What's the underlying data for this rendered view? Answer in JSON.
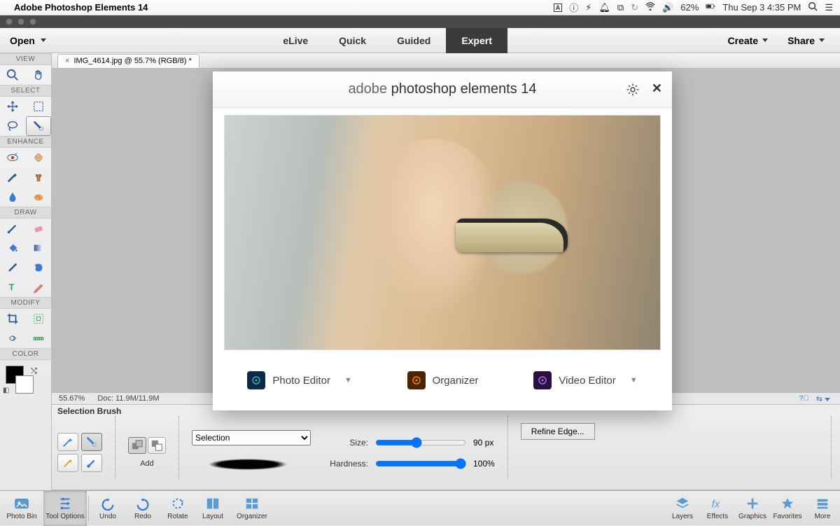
{
  "menubar": {
    "app_title": "Adobe Photoshop Elements 14",
    "battery": "62%",
    "clock": "Thu Sep 3  4:35 PM"
  },
  "topbar": {
    "open": "Open",
    "tabs": {
      "elive": "eLive",
      "quick": "Quick",
      "guided": "Guided",
      "expert": "Expert"
    },
    "create": "Create",
    "share": "Share"
  },
  "doc_tab": {
    "label": "IMG_4614.jpg @ 55.7% (RGB/8) *"
  },
  "tool_sections": {
    "view": "VIEW",
    "select": "SELECT",
    "enhance": "ENHANCE",
    "draw": "DRAW",
    "modify": "MODIFY",
    "color": "COLOR"
  },
  "status": {
    "zoom": "55.67%",
    "doc": "Doc: 11.9M/11.9M"
  },
  "tool_options": {
    "title": "Selection Brush",
    "mode_label": "Add",
    "combo_value": "Selection",
    "size_label": "Size:",
    "size_value": "90 px",
    "hardness_label": "Hardness:",
    "hardness_value": "100%",
    "refine": "Refine Edge..."
  },
  "bottombar": {
    "photo_bin": "Photo Bin",
    "tool_options": "Tool Options",
    "undo": "Undo",
    "redo": "Redo",
    "rotate": "Rotate",
    "layout": "Layout",
    "organizer": "Organizer",
    "layers": "Layers",
    "effects": "Effects",
    "graphics": "Graphics",
    "favorites": "Favorites",
    "more": "More"
  },
  "welcome": {
    "title_light": "adobe ",
    "title_bold": "photoshop elements 14",
    "photo_editor": "Photo Editor",
    "organizer": "Organizer",
    "video_editor": "Video Editor"
  }
}
